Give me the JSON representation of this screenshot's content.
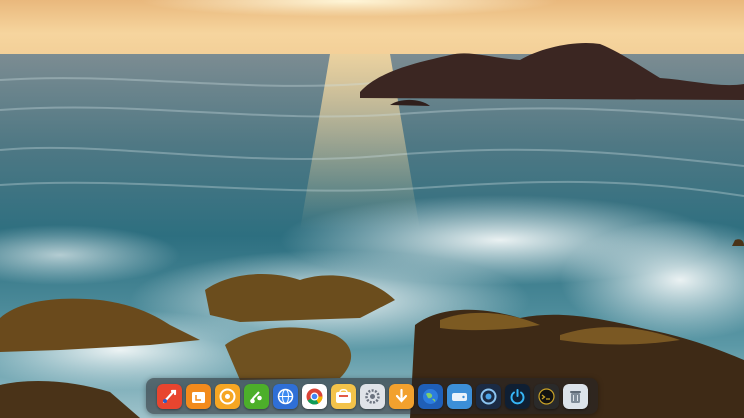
{
  "desktop": {
    "wallpaper": "sunset-ocean-rocks"
  },
  "dock": {
    "items": [
      {
        "name": "launcher-icon",
        "bg": "#e8452f"
      },
      {
        "name": "file-manager-icon",
        "bg": "#f28a1c"
      },
      {
        "name": "music-player-icon",
        "bg": "#f6a623"
      },
      {
        "name": "media-player-icon",
        "bg": "#4caf2a"
      },
      {
        "name": "network-globe-icon",
        "bg": "#2f6fd6"
      },
      {
        "name": "chrome-browser-icon",
        "bg": "#ffffff"
      },
      {
        "name": "app-store-icon",
        "bg": "#f3c34a"
      },
      {
        "name": "settings-icon",
        "bg": "#dfe3e8"
      },
      {
        "name": "download-icon",
        "bg": "#f2a12e"
      },
      {
        "name": "web-browser-icon",
        "bg": "#1f5fb8"
      },
      {
        "name": "disk-drive-icon",
        "bg": "#3c8fd8"
      },
      {
        "name": "system-monitor-icon",
        "bg": "#1b2b44"
      },
      {
        "name": "power-icon",
        "bg": "#0f1f33"
      },
      {
        "name": "terminal-icon",
        "bg": "#2a2a2a"
      },
      {
        "name": "trash-icon",
        "bg": "#dce3ea"
      }
    ]
  }
}
